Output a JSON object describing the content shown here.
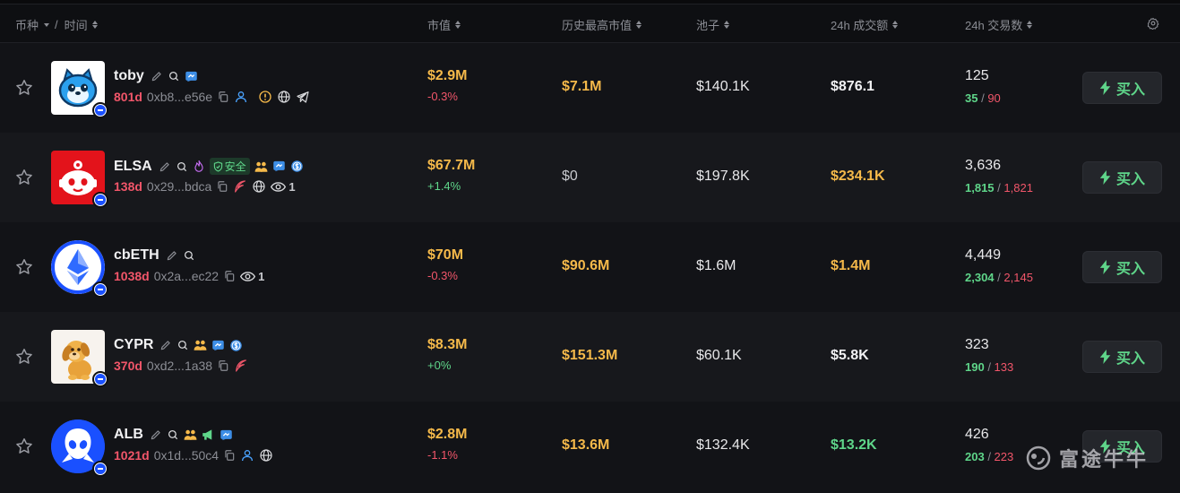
{
  "header": {
    "coin_label": "币种",
    "separator": "/",
    "time_label": "时间",
    "market_cap": "市值",
    "ath_market_cap": "历史最高市值",
    "pool": "池子",
    "volume_24h": "24h 成交额",
    "txs_24h": "24h 交易数"
  },
  "buy_label": "买入",
  "safe_label": "安全",
  "watermark": "富途牛牛",
  "colors": {
    "gold": "#f5b94a",
    "green": "#5fd68a",
    "red": "#f2566a",
    "chain_blue": "#1a50ff"
  },
  "rows": [
    {
      "name": "toby",
      "age": "801d",
      "address": "0xb8...e56e",
      "market_cap": "$2.9M",
      "change": "-0.3%",
      "ath": "$7.1M",
      "pool": "$140.1K",
      "volume": "$876.1",
      "txs": "125",
      "buys": "35",
      "sells": "90",
      "icons": [
        "edit-icon",
        "search-icon",
        "twitter-icon",
        "copy-icon",
        "user-icon",
        "warning-icon",
        "globe-icon",
        "telegram-icon"
      ]
    },
    {
      "name": "ELSA",
      "age": "138d",
      "address": "0x29...bdca",
      "market_cap": "$67.7M",
      "change": "+1.4%",
      "ath": "$0",
      "pool": "$197.8K",
      "volume": "$234.1K",
      "txs": "3,636",
      "buys": "1,815",
      "sells": "1,821",
      "views": "1",
      "icons": [
        "edit-icon",
        "search-icon",
        "fire-icon",
        "safe-badge",
        "holders-icon",
        "twitter-icon",
        "dollar-icon",
        "copy-icon",
        "feather-icon",
        "globe-icon",
        "eye-icon"
      ]
    },
    {
      "name": "cbETH",
      "age": "1038d",
      "address": "0x2a...ec22",
      "market_cap": "$70M",
      "change": "-0.3%",
      "ath": "$90.6M",
      "pool": "$1.6M",
      "volume": "$1.4M",
      "txs": "4,449",
      "buys": "2,304",
      "sells": "2,145",
      "views": "1",
      "icons": [
        "edit-icon",
        "search-icon",
        "copy-icon",
        "eye-icon"
      ]
    },
    {
      "name": "CYPR",
      "age": "370d",
      "address": "0xd2...1a38",
      "market_cap": "$8.3M",
      "change": "+0%",
      "ath": "$151.3M",
      "pool": "$60.1K",
      "volume": "$5.8K",
      "txs": "323",
      "buys": "190",
      "sells": "133",
      "icons": [
        "edit-icon",
        "search-icon",
        "holders-icon",
        "twitter-icon",
        "dollar-icon",
        "copy-icon",
        "feather-icon"
      ]
    },
    {
      "name": "ALB",
      "age": "1021d",
      "address": "0x1d...50c4",
      "market_cap": "$2.8M",
      "change": "-1.1%",
      "ath": "$13.6M",
      "pool": "$132.4K",
      "volume": "$13.2K",
      "txs": "426",
      "buys": "203",
      "sells": "223",
      "icons": [
        "edit-icon",
        "search-icon",
        "holders-icon",
        "megaphone-icon",
        "twitter-icon",
        "copy-icon",
        "user-icon",
        "globe-icon"
      ]
    }
  ]
}
